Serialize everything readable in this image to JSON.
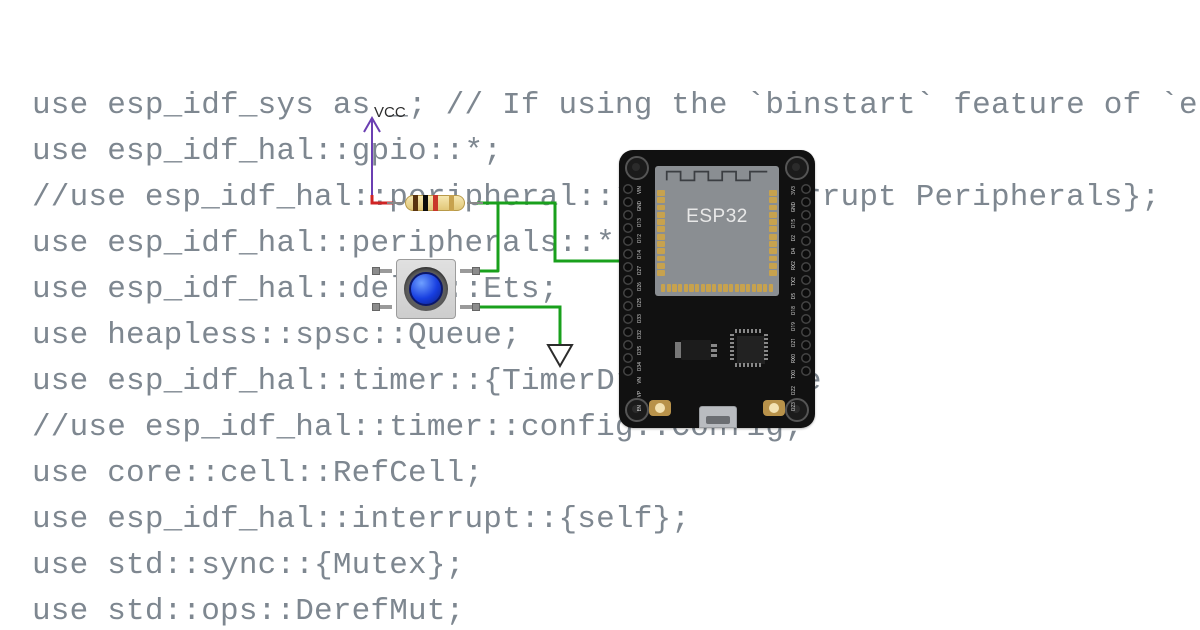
{
  "code_lines": [
    "use esp_idf_sys as _; // If using the `binstart` feature of `esp-idf-sys`, always k",
    "use esp_idf_hal::gpio::*;",
    "//use esp_idf_hal::peripheral::*; //{Interrupt Peripherals};",
    "use esp_idf_hal::peripherals::*;",
    "use esp_idf_hal::delay::Ets;",
    "use heapless::spsc::Queue;",
    "use esp_idf_hal::timer::{TimerDriver, Time",
    "//use esp_idf_hal::timer::config::Config;",
    "use core::cell::RefCell;",
    "use esp_idf_hal::interrupt::{self};",
    "use std::sync::{Mutex};",
    "use std::ops::DerefMut;"
  ],
  "labels": {
    "vcc": "VCC",
    "chip": "ESP32"
  },
  "pins_left": [
    "VIN",
    "GND",
    "D13",
    "D12",
    "D14",
    "D27",
    "D26",
    "D25",
    "D33",
    "D32",
    "D35",
    "D34",
    "VN",
    "VP",
    "EN"
  ],
  "pins_right": [
    "3V3",
    "GND",
    "D15",
    "D2",
    "D4",
    "RX2",
    "TX2",
    "D5",
    "D18",
    "D19",
    "D21",
    "RX0",
    "TX0",
    "D22",
    "D23"
  ],
  "components": {
    "board": "ESP32 DevKit",
    "button": "momentary push button (blue cap)",
    "resistor": "axial pull-up resistor",
    "resistor_bands": [
      "brown",
      "black",
      "red",
      "gold"
    ]
  },
  "wires": {
    "green_signal": "button top-right → resistor right lead, jumper right to ESP32 left pin row (GPIO)",
    "green_gnd": "button bottom-right → down to ground symbol",
    "red_vcc": "resistor left lead → up to VCC arrow"
  },
  "colors": {
    "wire_green": "#19a01c",
    "wire_red": "#d02424",
    "code_text": "#7e8790",
    "board_black": "#111111",
    "shield_grey": "#8a8e92",
    "button_blue": "#173ee0"
  }
}
